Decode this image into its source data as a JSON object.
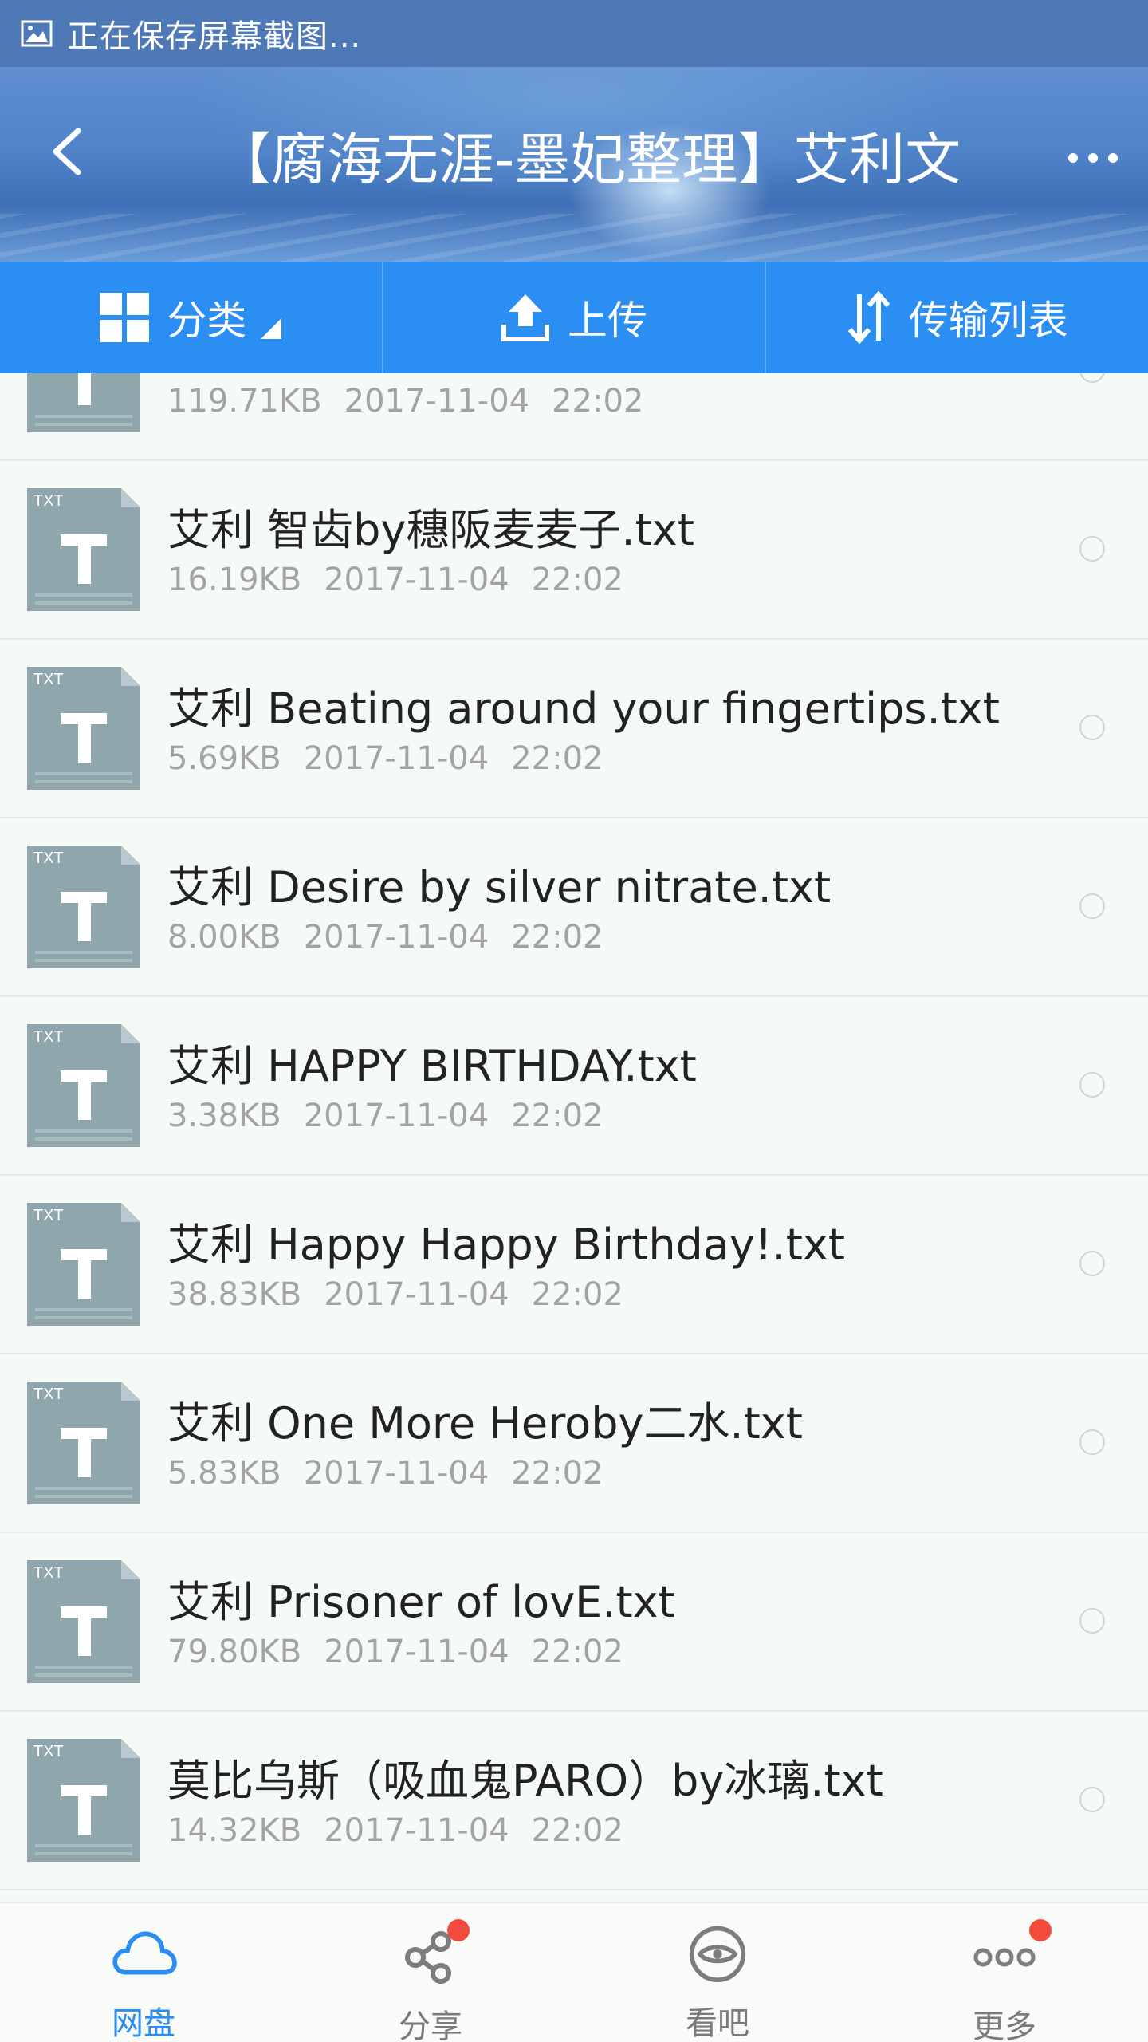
{
  "status_bar": {
    "text": "正在保存屏幕截图...",
    "icon": "image-icon"
  },
  "header": {
    "title": "【腐海无涯-墨妃整理】艾利文",
    "back_icon": "back-arrow-icon",
    "more_icon": "more-dots-icon"
  },
  "toolbar": {
    "category_label": "分类",
    "upload_label": "上传",
    "transfer_label": "传输列表"
  },
  "files": [
    {
      "name": "",
      "size": "119.71KB",
      "date": "2017-11-04",
      "time": "22:02",
      "type": "TXT"
    },
    {
      "name": "艾利 智齿by穗阪麦麦子.txt",
      "size": "16.19KB",
      "date": "2017-11-04",
      "time": "22:02",
      "type": "TXT"
    },
    {
      "name": "艾利 Beating around your fingertips.txt",
      "size": "5.69KB",
      "date": "2017-11-04",
      "time": "22:02",
      "type": "TXT"
    },
    {
      "name": "艾利 Desire by silver nitrate.txt",
      "size": "8.00KB",
      "date": "2017-11-04",
      "time": "22:02",
      "type": "TXT"
    },
    {
      "name": "艾利 HAPPY BIRTHDAY.txt",
      "size": "3.38KB",
      "date": "2017-11-04",
      "time": "22:02",
      "type": "TXT"
    },
    {
      "name": "艾利 Happy Happy Birthday!.txt",
      "size": "38.83KB",
      "date": "2017-11-04",
      "time": "22:02",
      "type": "TXT"
    },
    {
      "name": "艾利 One More Heroby二水.txt",
      "size": "5.83KB",
      "date": "2017-11-04",
      "time": "22:02",
      "type": "TXT"
    },
    {
      "name": "艾利 Prisoner of lovE.txt",
      "size": "79.80KB",
      "date": "2017-11-04",
      "time": "22:02",
      "type": "TXT"
    },
    {
      "name": "莫比乌斯（吸血鬼PARO）by冰璃.txt",
      "size": "14.32KB",
      "date": "2017-11-04",
      "time": "22:02",
      "type": "TXT"
    }
  ],
  "bottom_nav": [
    {
      "label": "网盘",
      "icon": "cloud-icon",
      "active": true,
      "badge": false
    },
    {
      "label": "分享",
      "icon": "share-icon",
      "active": false,
      "badge": true
    },
    {
      "label": "看吧",
      "icon": "eye-icon",
      "active": false,
      "badge": false
    },
    {
      "label": "更多",
      "icon": "more-icon",
      "active": false,
      "badge": true
    }
  ],
  "colors": {
    "accent": "#2b8ef3",
    "badge": "#f24b3d",
    "file_icon": "#8fa6ad"
  }
}
